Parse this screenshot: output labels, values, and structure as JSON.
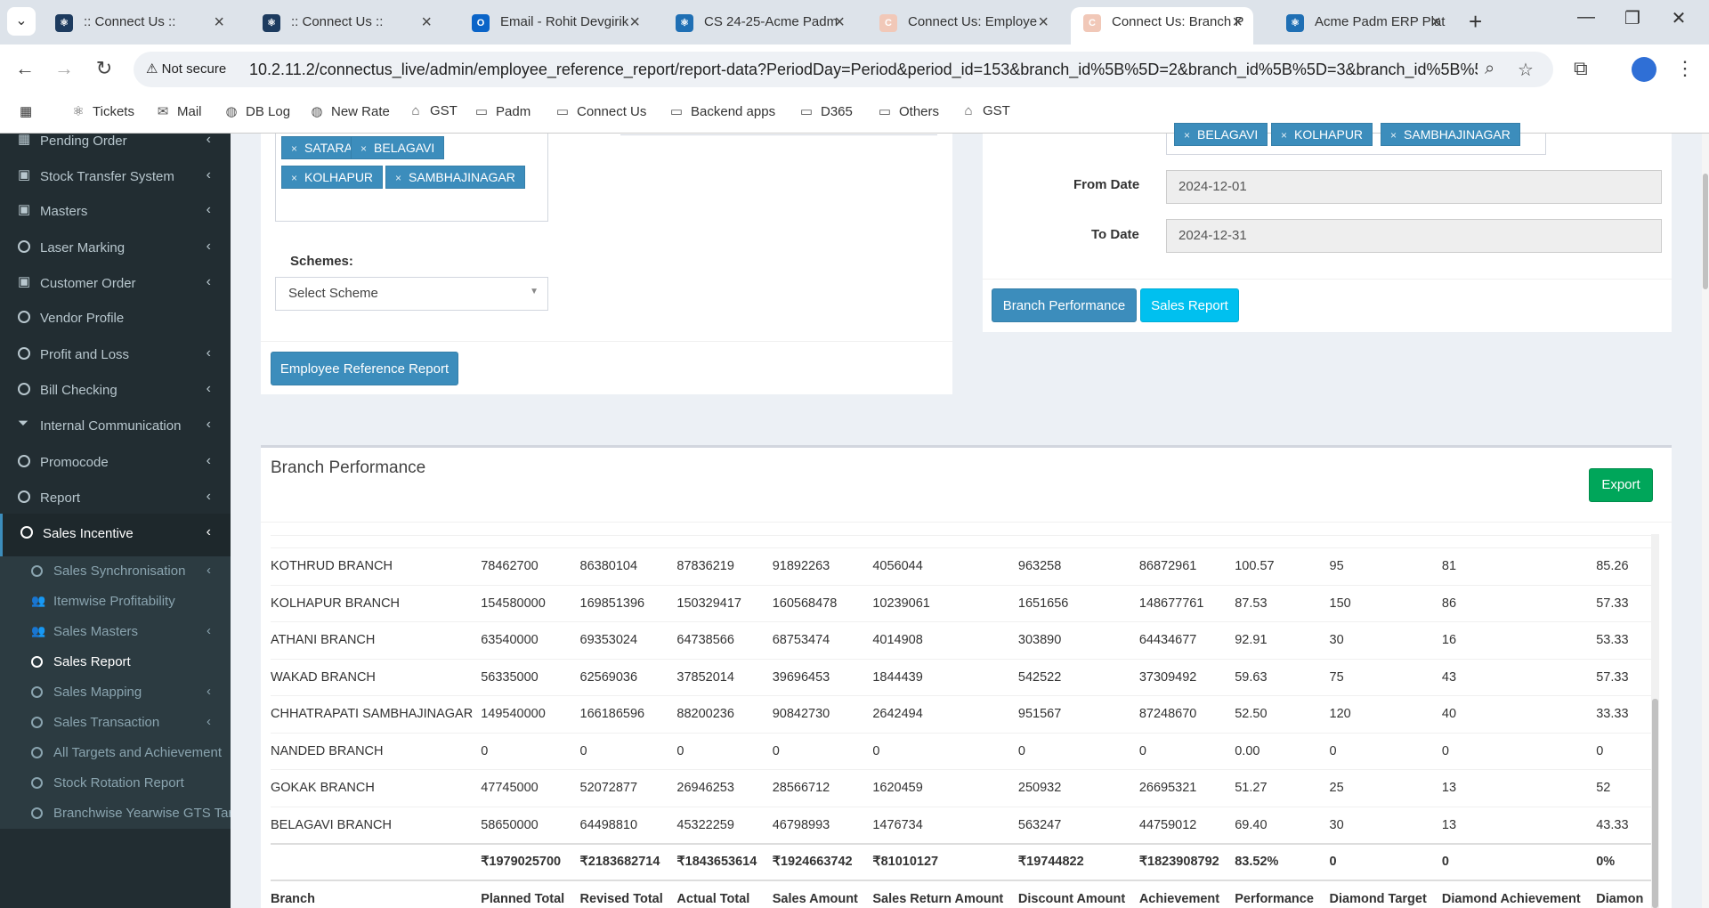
{
  "browser": {
    "tabs": [
      {
        "title": ":: Connect Us ::",
        "favicon": "react-icon",
        "active": false
      },
      {
        "title": ":: Connect Us ::",
        "favicon": "react-icon",
        "active": false
      },
      {
        "title": "Email - Rohit Devgirik",
        "favicon": "outlook-icon",
        "active": false
      },
      {
        "title": "CS 24-25-Acme Padm",
        "favicon": "app-icon",
        "active": false
      },
      {
        "title": "Connect Us: Employe",
        "favicon": "connectus-icon",
        "active": false
      },
      {
        "title": "Connect Us: Branch P",
        "favicon": "connectus-icon",
        "active": true
      },
      {
        "title": "Acme Padm ERP Plat",
        "favicon": "app-icon",
        "active": false
      }
    ],
    "security_label": "Not secure",
    "url": "10.2.11.2/connectus_live/admin/employee_reference_report/report-data?PeriodDay=Period&period_id=153&branch_id%5B%5D=2&branch_id%5B%5D=3&branch_id%5B%5D...",
    "bookmarks": [
      {
        "label": "Tickets",
        "icon": "react-icon"
      },
      {
        "label": "Mail",
        "icon": "outlook-icon"
      },
      {
        "label": "DB Log",
        "icon": "globe-icon"
      },
      {
        "label": "New Rate",
        "icon": "globe-icon"
      },
      {
        "label": "GST",
        "icon": "gov-icon"
      },
      {
        "label": "Padm",
        "icon": "folder-icon"
      },
      {
        "label": "Connect Us",
        "icon": "folder-icon"
      },
      {
        "label": "Backend apps",
        "icon": "folder-icon"
      },
      {
        "label": "D365",
        "icon": "folder-icon"
      },
      {
        "label": "Others",
        "icon": "folder-icon"
      },
      {
        "label": "GST",
        "icon": "gov-icon"
      }
    ]
  },
  "sidebar": {
    "items": [
      {
        "label": "Pending Order",
        "icon": "table-icon",
        "chevron": true
      },
      {
        "label": "Stock Transfer System",
        "icon": "money-icon",
        "chevron": true
      },
      {
        "label": "Masters",
        "icon": "money-icon",
        "chevron": true
      },
      {
        "label": "Laser Marking",
        "icon": "circle-icon",
        "chevron": true
      },
      {
        "label": "Customer Order",
        "icon": "money-icon",
        "chevron": true
      },
      {
        "label": "Vendor Profile",
        "icon": "circle-icon",
        "chevron": false
      },
      {
        "label": "Profit and Loss",
        "icon": "circle-icon",
        "chevron": true
      },
      {
        "label": "Bill Checking",
        "icon": "circle-icon",
        "chevron": true
      },
      {
        "label": "Internal Communication",
        "icon": "filter-icon",
        "chevron": true
      },
      {
        "label": "Promocode",
        "icon": "circle-icon",
        "chevron": true
      },
      {
        "label": "Report",
        "icon": "circle-icon",
        "chevron": true
      },
      {
        "label": "Sales Incentive",
        "icon": "circle-icon",
        "chevron": true
      }
    ],
    "subitems": [
      {
        "label": "Sales Synchronisation",
        "icon": "circle-icon",
        "chevron": true
      },
      {
        "label": "Itemwise Profitability",
        "icon": "users-icon",
        "chevron": false
      },
      {
        "label": "Sales Masters",
        "icon": "users-icon",
        "chevron": true
      },
      {
        "label": "Sales Report",
        "icon": "circle-icon",
        "chevron": false
      },
      {
        "label": "Sales Mapping",
        "icon": "circle-icon",
        "chevron": true
      },
      {
        "label": "Sales Transaction",
        "icon": "circle-icon",
        "chevron": true
      },
      {
        "label": "All Targets and Achievement",
        "icon": "circle-icon",
        "chevron": false
      },
      {
        "label": "Stock Rotation Report",
        "icon": "circle-icon",
        "chevron": false
      },
      {
        "label": "Branchwise Yearwise GTS Targ",
        "icon": "circle-icon",
        "chevron": false
      }
    ]
  },
  "left_form": {
    "branch_chips": [
      "SATARA",
      "BELAGAVI",
      "KOLHAPUR",
      "SAMBHAJINAGAR"
    ],
    "schemes_label": "Schemes:",
    "scheme_placeholder": "Select Scheme",
    "report_button": "Employee Reference Report"
  },
  "right_form": {
    "branch_chips": [
      "BELAGAVI",
      "KOLHAPUR",
      "SAMBHAJINAGAR"
    ],
    "from_label": "From Date",
    "from_value": "2024-12-01",
    "to_label": "To Date",
    "to_value": "2024-12-31",
    "branch_performance_button": "Branch Performance",
    "sales_report_button": "Sales Report"
  },
  "panel": {
    "title": "Branch Performance",
    "export_button": "Export"
  },
  "table": {
    "rows": [
      [
        "KOTHRUD BRANCH",
        "78462700",
        "86380104",
        "87836219",
        "91892263",
        "4056044",
        "963258",
        "86872961",
        "100.57",
        "95",
        "81",
        "85.26"
      ],
      [
        "KOLHAPUR BRANCH",
        "154580000",
        "169851396",
        "150329417",
        "160568478",
        "10239061",
        "1651656",
        "148677761",
        "87.53",
        "150",
        "86",
        "57.33"
      ],
      [
        "ATHANI BRANCH",
        "63540000",
        "69353024",
        "64738566",
        "68753474",
        "4014908",
        "303890",
        "64434677",
        "92.91",
        "30",
        "16",
        "53.33"
      ],
      [
        "WAKAD BRANCH",
        "56335000",
        "62569036",
        "37852014",
        "39696453",
        "1844439",
        "542522",
        "37309492",
        "59.63",
        "75",
        "43",
        "57.33"
      ],
      [
        "CHHATRAPATI SAMBHAJINAGAR",
        "149540000",
        "166186596",
        "88200236",
        "90842730",
        "2642494",
        "951567",
        "87248670",
        "52.50",
        "120",
        "40",
        "33.33"
      ],
      [
        "NANDED BRANCH",
        "0",
        "0",
        "0",
        "0",
        "0",
        "0",
        "0",
        "0.00",
        "0",
        "0",
        "0"
      ],
      [
        "GOKAK BRANCH",
        "47745000",
        "52072877",
        "26946253",
        "28566712",
        "1620459",
        "250932",
        "26695321",
        "51.27",
        "25",
        "13",
        "52"
      ],
      [
        "BELAGAVI BRANCH",
        "58650000",
        "64498810",
        "45322259",
        "46798993",
        "1476734",
        "563247",
        "44759012",
        "69.40",
        "30",
        "13",
        "43.33"
      ]
    ],
    "totals": [
      "",
      "₹1979025700",
      "₹2183682714",
      "₹1843653614",
      "₹1924663742",
      "₹81010127",
      "₹19744822",
      "₹1823908792",
      "83.52%",
      "0",
      "0",
      "0%"
    ],
    "headers": [
      "Branch",
      "Planned Total",
      "Revised Total",
      "Actual Total",
      "Sales Amount",
      "Sales Return Amount",
      "Discount Amount",
      "Achievement",
      "Performance",
      "Diamond Target",
      "Diamond Achievement",
      "Diamon"
    ]
  },
  "colors": {
    "sidebar_bg": "#222d32",
    "primary": "#3c8dbc",
    "info": "#00c0ef",
    "success": "#00a65a"
  }
}
